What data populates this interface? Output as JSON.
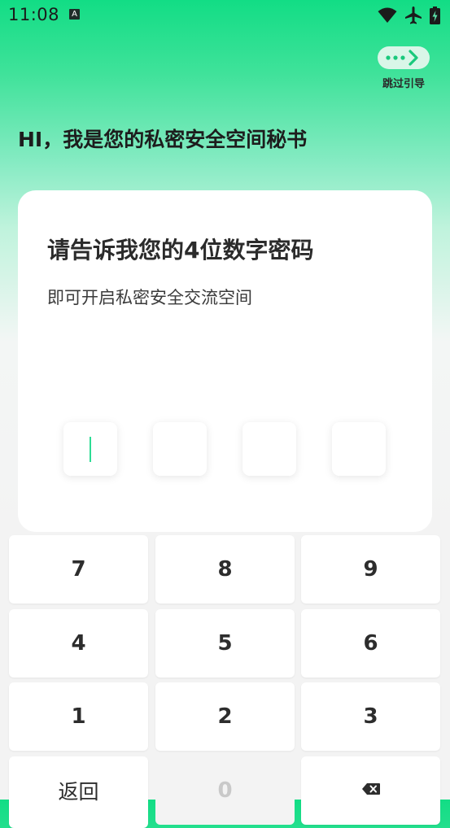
{
  "status_bar": {
    "time": "11:08",
    "notification_badge": "A"
  },
  "skip": {
    "label": "跳过引导"
  },
  "greeting": "HI，我是您的私密安全空间秘书",
  "card": {
    "title": "请告诉我您的4位数字密码",
    "subtitle": "即可开启私密安全交流空间",
    "pin_length": 4,
    "pin_entered": 0
  },
  "keypad": {
    "row1": [
      "7",
      "8",
      "9"
    ],
    "row2": [
      "4",
      "5",
      "6"
    ],
    "row3": [
      "1",
      "2",
      "3"
    ],
    "back_label": "返回",
    "zero_label": "0",
    "delete_icon": "backspace-icon"
  },
  "colors": {
    "accent": "#2ddc95",
    "header_gradient_top": "#12dd85"
  }
}
